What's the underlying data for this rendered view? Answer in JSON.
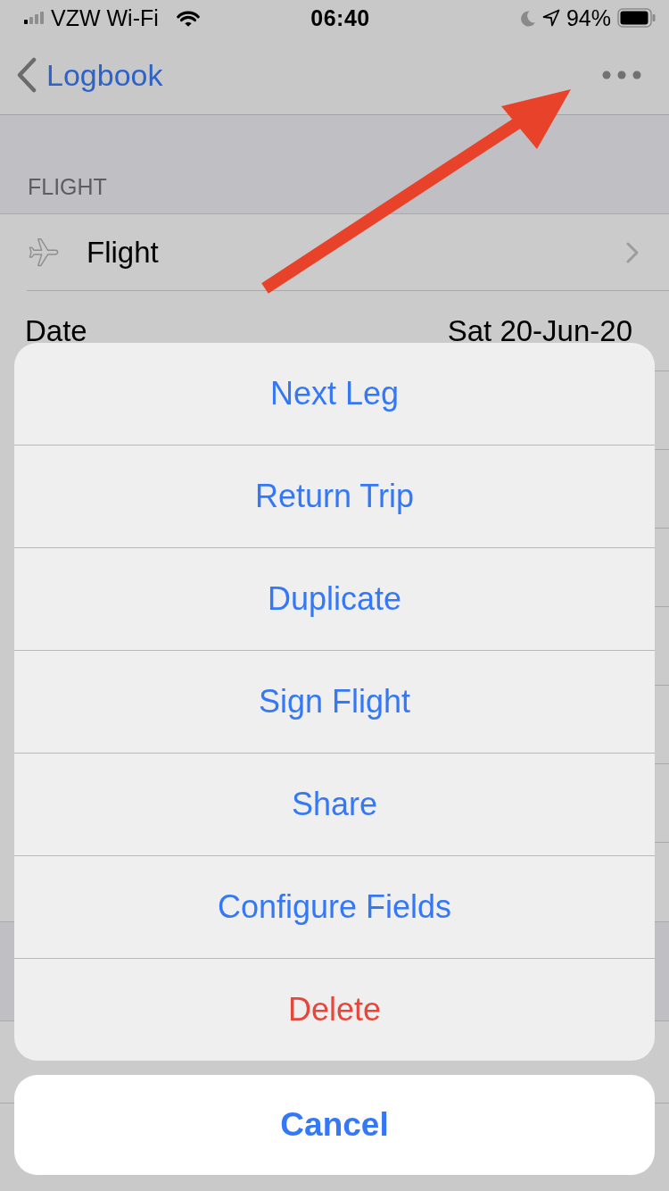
{
  "status_bar": {
    "carrier": "VZW Wi-Fi",
    "time": "06:40",
    "battery": "94%"
  },
  "nav_bar": {
    "back_label": "Logbook"
  },
  "section": {
    "header": "FLIGHT",
    "rows": [
      {
        "kind": "link",
        "label": "Flight"
      },
      {
        "kind": "value",
        "label": "Date",
        "value": "Sat 20-Jun-20"
      }
    ]
  },
  "action_sheet": {
    "actions": [
      {
        "label": "Next Leg",
        "kind": "default"
      },
      {
        "label": "Return Trip",
        "kind": "default"
      },
      {
        "label": "Duplicate",
        "kind": "default"
      },
      {
        "label": "Sign Flight",
        "kind": "default"
      },
      {
        "label": "Share",
        "kind": "default"
      },
      {
        "label": "Configure Fields",
        "kind": "default"
      },
      {
        "label": "Delete",
        "kind": "destructive"
      }
    ],
    "cancel": "Cancel"
  }
}
